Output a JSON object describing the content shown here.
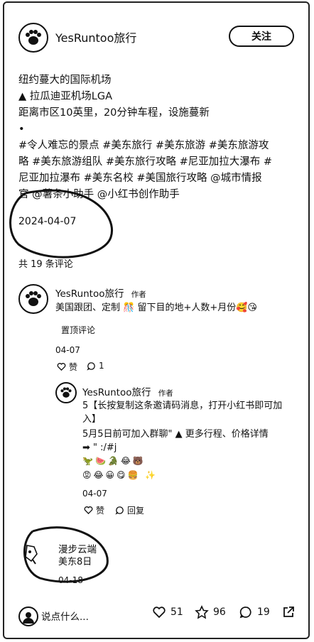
{
  "header": {
    "author": "YesRuntoo旅行",
    "follow_label": "关注"
  },
  "post": {
    "lines": [
      "纽约蔓大的国际机场",
      "▲ 拉瓜迪亚机场LGA",
      "距离市区10英里，20分钟车程，设施蔓新",
      "•"
    ],
    "tags_1": "#令人难忘的景点 #美东旅行 #美东旅游 #美东旅游攻",
    "tags_2": "略 #美东旅游组队 #美东旅行攻略 #尼亚加拉大瀑布 #",
    "tags_3": "尼亚加拉瀑布 #美东名校 #美国旅行攻略 @城市情报",
    "tags_4": "官 @薯条小助手 @小红书创作助手",
    "date": "2024-04-07"
  },
  "comments_count": "共 19 条评论",
  "comments": [
    {
      "author": "YesRuntoo旅行",
      "author_tag": "作者",
      "text": "美国跟团、定制 🎊 留下目的地+人数+月份🥰😘",
      "pinned": "置顶评论",
      "date": "04-07",
      "like_label": "赞",
      "reply_count": "1"
    },
    {
      "author": "YesRuntoo旅行",
      "author_tag": "作者",
      "text_1": "5【长按复制这条邀请码消息，打开小红书即可加",
      "text_2": "入】",
      "text_3": "5月5日前可加入群聊\" ▲ 更多行程、价格详情",
      "text_4": "➡ \" :/#j",
      "emoji_1": "🦖🍉🐊😂🐻",
      "emoji_2": "😡😂😀😋🍔 ✨",
      "date": "04-07",
      "like_label": "赞",
      "reply_label": "回复"
    },
    {
      "author": "漫步云端",
      "text": "美东8日",
      "date": "04-18"
    }
  ],
  "bottom_bar": {
    "input_placeholder": "说点什么...",
    "likes": "51",
    "stars": "96",
    "comments": "19"
  }
}
